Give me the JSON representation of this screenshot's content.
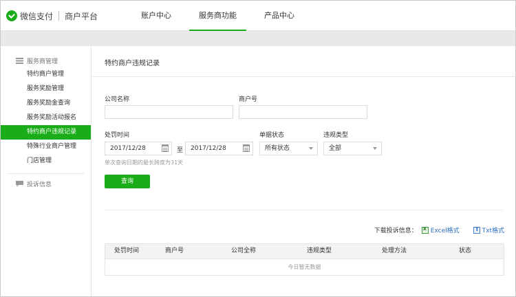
{
  "header": {
    "brand": "微信支付",
    "platform": "商户平台",
    "nav": [
      "账户中心",
      "服务商功能",
      "产品中心"
    ],
    "active_nav": "服务商功能"
  },
  "sidebar": {
    "group1_title": "服务商管理",
    "items": [
      "特约商户管理",
      "服务奖励管理",
      "服务奖励金查询",
      "服务奖励活动报名",
      "特约商户违规记录",
      "特殊行业商户管理",
      "门店管理"
    ],
    "active_item": "特约商户违规记录",
    "group2_title": "投诉信息"
  },
  "main": {
    "title": "特约商户违规记录",
    "form": {
      "company_label": "公司名称",
      "company_value": "",
      "merchant_label": "商户号",
      "merchant_value": "",
      "time_label": "处罚时间",
      "date_from": "2017/12/28",
      "date_sep": "至",
      "date_to": "2017/12/28",
      "status_label": "单据状态",
      "status_value": "所有状态",
      "type_label": "违规类型",
      "type_value": "全部",
      "hint": "单次查询日期的最长跨度为31天",
      "query_button": "查询"
    },
    "download": {
      "label": "下载投诉信息：",
      "excel": "Excel格式",
      "txt": "Txt格式"
    },
    "table": {
      "columns": [
        "处罚时间",
        "商户号",
        "公司全称",
        "违规类型",
        "处理方法",
        "状态"
      ],
      "empty_text": "今日暂无数据"
    }
  },
  "colors": {
    "accent": "#1aad19",
    "link": "#2b6fc2"
  }
}
